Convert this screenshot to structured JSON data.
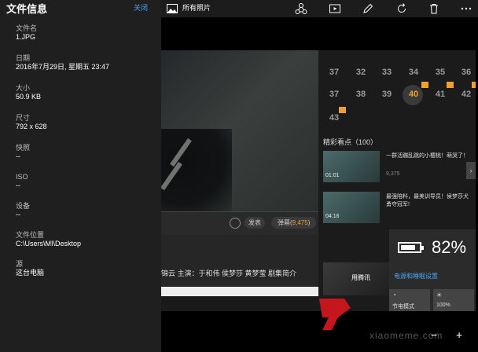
{
  "info_panel": {
    "title": "文件信息",
    "close_label": "关闭",
    "fields": [
      {
        "label": "文件名",
        "value": "1.JPG"
      },
      {
        "label": "日期",
        "value": "2016年7月29日, 星期五 23:47"
      },
      {
        "label": "大小",
        "value": "50.9 KB"
      },
      {
        "label": "尺寸",
        "value": "792 x 628"
      },
      {
        "label": "快照",
        "value": "--"
      },
      {
        "label": "ISO",
        "value": "--"
      },
      {
        "label": "设备",
        "value": "--"
      },
      {
        "label": "文件位置",
        "value": "C:\\Users\\MI\\Desktop"
      },
      {
        "label": "源",
        "value": "这台电脑"
      }
    ]
  },
  "toolbar": {
    "all_photos_label": "所有照片",
    "icons": [
      "share-icon",
      "slideshow-icon",
      "edit-icon",
      "rotate-icon",
      "delete-icon",
      "more-icon"
    ]
  },
  "photo": {
    "episodes_row1": [
      "37",
      "32",
      "33",
      "34",
      "35",
      "36"
    ],
    "episodes_row2": [
      "37",
      "38",
      "39",
      "40",
      "41",
      "42"
    ],
    "episodes_row3": [
      "43"
    ],
    "highlights_title": "精彩看点（100）",
    "highlights": [
      {
        "time": "01:01",
        "text": "一群活蹦乱跳的小樱桃！萌哭了！",
        "views": "9,375"
      },
      {
        "time": "04:16",
        "text": "最强陪料，最美训导员！侯梦莎犬勇夺冠军!",
        "views": ""
      }
    ],
    "comment": {
      "send": "发表",
      "danmu_prefix": "弹幕(",
      "danmu_count": "9,475",
      "danmu_suffix": ")"
    },
    "cast_line": "锦云  主演：于和伟 侯梦莎 黄梦莹 剧集简介",
    "news_label": "用腾讯",
    "battery": {
      "percent": "82%",
      "level": 0.82,
      "link": "电源和睡眠设置",
      "tile1_label": "节电模式",
      "tile2_label": "100%"
    }
  },
  "watermark": {
    "url": "xiaomeme.com"
  },
  "zoom": {
    "out": "−",
    "in": "+"
  }
}
